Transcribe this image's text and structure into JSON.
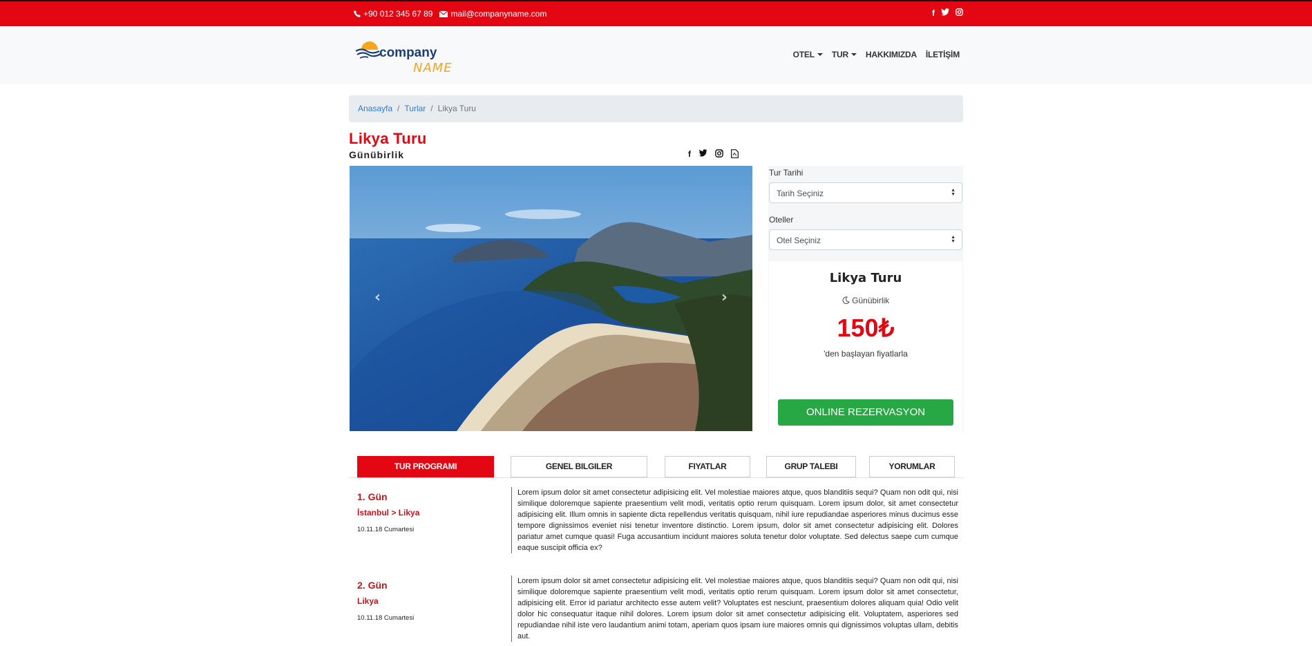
{
  "topbar": {
    "phone": "+90 012 345 67 89",
    "email": "mail@companyname.com",
    "social_icons": [
      "facebook-icon",
      "twitter-icon",
      "instagram-icon"
    ]
  },
  "logo": {
    "line1": "company",
    "line2": "NAME"
  },
  "nav": {
    "items": [
      {
        "label": "OTEL",
        "dropdown": true
      },
      {
        "label": "TUR",
        "dropdown": true
      },
      {
        "label": "HAKKIMIZDA",
        "dropdown": false
      },
      {
        "label": "İLETİŞİM",
        "dropdown": false
      }
    ]
  },
  "breadcrumb": {
    "home": "Anasayfa",
    "section": "Turlar",
    "current": "Likya Turu"
  },
  "tour": {
    "title": "Likya Turu",
    "duration": "Günübirlik",
    "share_icons": [
      "facebook-icon",
      "twitter-icon",
      "instagram-icon",
      "pdf-icon"
    ]
  },
  "booking": {
    "date_label": "Tur Tarihi",
    "date_value": "Tarih Seçiniz",
    "hotel_label": "Oteller",
    "hotel_value": "Otel Seçiniz",
    "card_title": "Likya Turu",
    "card_duration": "Günübirlik",
    "price": "150₺",
    "price_note": "'den başlayan fiyatlarla",
    "reserve_button": "ONLINE REZERVASYON"
  },
  "tabs": [
    "TUR PROGRAMI",
    "GENEL BILGILER",
    "FIYATLAR",
    "GRUP TALEBI",
    "YORUMLAR"
  ],
  "program": [
    {
      "day": "1. Gün",
      "route": "İstanbul > Likya",
      "date": "10.11.18 Cumartesi",
      "text": "Lorem ipsum dolor sit amet consectetur adipisicing elit. Vel molestiae maiores atque, quos blanditiis sequi? Quam non odit qui, nisi similique doloremque sapiente praesentium velit modi, veritatis optio rerum quisquam. Lorem ipsum dolor, sit amet consectetur adipisicing elit. Illum omnis in sapiente dicta repellendus veritatis quisquam, nihil iure repudiandae asperiores minus ducimus esse tempore dignissimos eveniet nisi tenetur inventore distinctio. Lorem ipsum, dolor sit amet consectetur adipisicing elit. Dolores pariatur amet cumque quasi! Fuga accusantium incidunt maiores soluta tenetur dolor voluptate. Sed delectus saepe cum cumque eaque suscipit officia ex?"
    },
    {
      "day": "2. Gün",
      "route": "Likya",
      "date": "10.11.18 Cumartesi",
      "text": "Lorem ipsum dolor sit amet consectetur adipisicing elit. Vel molestiae maiores atque, quos blanditiis sequi? Quam non odit qui, nisi similique doloremque sapiente praesentium velit modi, veritatis optio rerum quisquam. Lorem ipsum dolor sit amet consectetur, adipisicing elit. Error id pariatur architecto esse autem velit? Voluptates est nesciunt, praesentium dolores aliquam quia! Odio velit dolor hic consequatur itaque nihil dolores. Lorem ipsum dolor sit amet consectetur adipisicing elit. Voluptatem, asperiores sed repudiandae nihil iste vero laudantium animi totam, aperiam quos ipsam iure maiores omnis qui dignissimos voluptas ullam, debitis aut."
    }
  ],
  "colors": {
    "brand_red": "#e30613",
    "success_green": "#28a745",
    "link_blue": "#2a7ae2"
  }
}
